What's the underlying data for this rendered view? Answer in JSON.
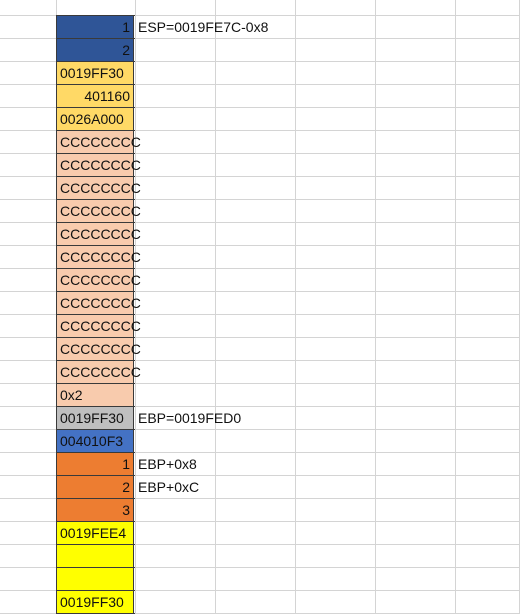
{
  "colors": {
    "dark_blue": "#2f5597",
    "medium_blue": "#4472c4",
    "gold": "#ffd966",
    "peach": "#f8cbad",
    "grey": "#bfbfbf",
    "orange": "#ed7d31",
    "yellow": "#ffff00",
    "white": "#ffffff"
  },
  "rows": [
    {
      "value": "1",
      "align": "right",
      "color": "dark_blue",
      "note": "ESP=0019FE7C-0x8"
    },
    {
      "value": "2",
      "align": "right",
      "color": "dark_blue",
      "note": ""
    },
    {
      "value": "0019FF30",
      "align": "left",
      "color": "gold",
      "note": ""
    },
    {
      "value": "401160",
      "align": "right",
      "color": "gold",
      "note": ""
    },
    {
      "value": "0026A000",
      "align": "left",
      "color": "gold",
      "note": ""
    },
    {
      "value": "CCCCCCCC",
      "align": "left",
      "color": "peach",
      "note": ""
    },
    {
      "value": "CCCCCCCC",
      "align": "left",
      "color": "peach",
      "note": ""
    },
    {
      "value": "CCCCCCCC",
      "align": "left",
      "color": "peach",
      "note": ""
    },
    {
      "value": "CCCCCCCC",
      "align": "left",
      "color": "peach",
      "note": ""
    },
    {
      "value": "CCCCCCCC",
      "align": "left",
      "color": "peach",
      "note": ""
    },
    {
      "value": "CCCCCCCC",
      "align": "left",
      "color": "peach",
      "note": ""
    },
    {
      "value": "CCCCCCCC",
      "align": "left",
      "color": "peach",
      "note": ""
    },
    {
      "value": "CCCCCCCC",
      "align": "left",
      "color": "peach",
      "note": ""
    },
    {
      "value": "CCCCCCCC",
      "align": "left",
      "color": "peach",
      "note": ""
    },
    {
      "value": "CCCCCCCC",
      "align": "left",
      "color": "peach",
      "note": ""
    },
    {
      "value": "CCCCCCCC",
      "align": "left",
      "color": "peach",
      "note": ""
    },
    {
      "value": "0x2",
      "align": "left",
      "color": "peach",
      "note": ""
    },
    {
      "value": "0019FF30",
      "align": "left",
      "color": "grey",
      "note": "EBP=0019FED0"
    },
    {
      "value": "004010F3",
      "align": "left",
      "color": "medium_blue",
      "note": ""
    },
    {
      "value": "1",
      "align": "right",
      "color": "orange",
      "note": "EBP+0x8"
    },
    {
      "value": "2",
      "align": "right",
      "color": "orange",
      "note": "EBP+0xC"
    },
    {
      "value": "3",
      "align": "right",
      "color": "orange",
      "note": ""
    },
    {
      "value": "0019FEE4",
      "align": "left",
      "color": "yellow",
      "note": ""
    },
    {
      "value": "",
      "align": "left",
      "color": "yellow",
      "note": ""
    },
    {
      "value": "",
      "align": "left",
      "color": "yellow",
      "note": ""
    },
    {
      "value": "0019FF30",
      "align": "left",
      "color": "yellow",
      "note": ""
    }
  ]
}
